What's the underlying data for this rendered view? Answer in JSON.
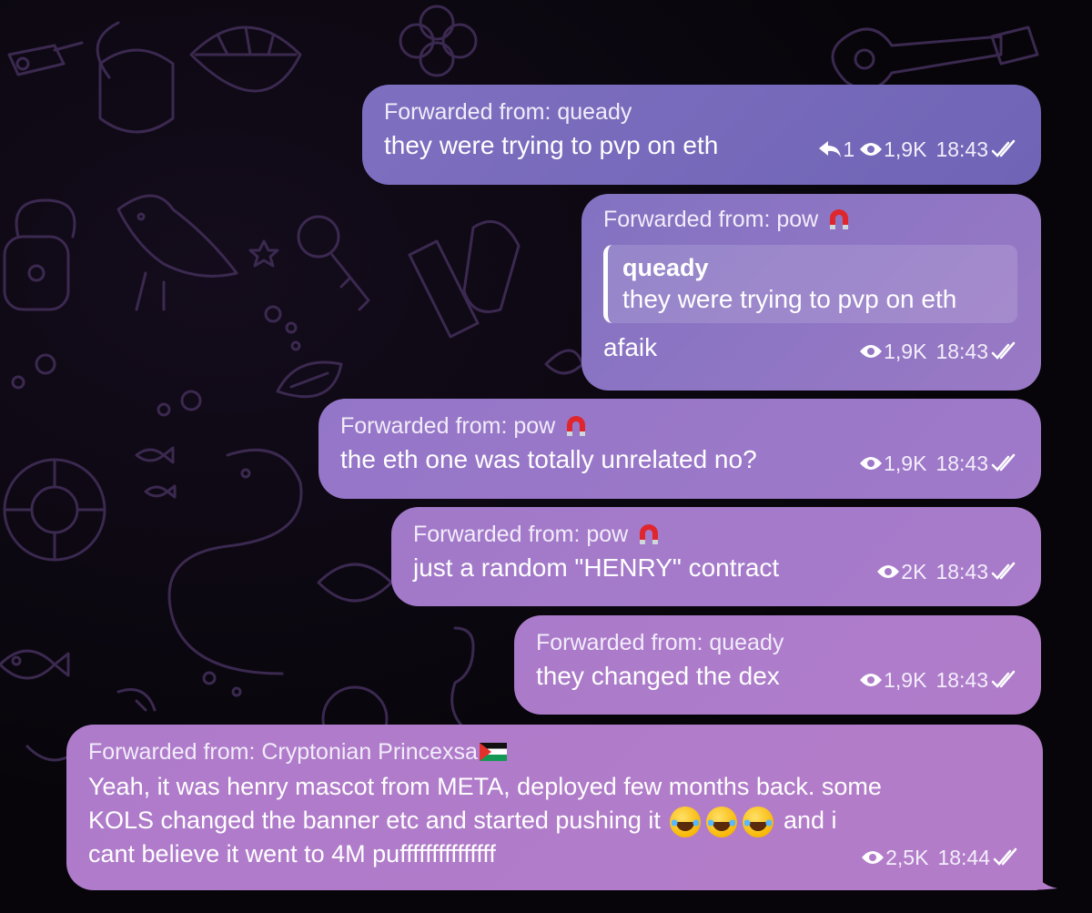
{
  "messages": [
    {
      "forwarded_from": "Forwarded from: queady",
      "text": "they were trying to pvp on eth",
      "replies": "1",
      "views": "1,9K",
      "time": "18:43",
      "badge_emoji": null
    },
    {
      "forwarded_from": "Forwarded from: pow",
      "badge_emoji": "magnet",
      "quote": {
        "author": "queady",
        "text": "they were trying to pvp on eth"
      },
      "text": "afaik",
      "views": "1,9K",
      "time": "18:43"
    },
    {
      "forwarded_from": "Forwarded from: pow",
      "badge_emoji": "magnet",
      "text": "the eth one was totally unrelated no?",
      "views": "1,9K",
      "time": "18:43"
    },
    {
      "forwarded_from": "Forwarded from: pow",
      "badge_emoji": "magnet",
      "text": "just a random \"HENRY\" contract",
      "views": "2K",
      "time": "18:43"
    },
    {
      "forwarded_from": "Forwarded from: queady",
      "text": "they changed the dex",
      "views": "1,9K",
      "time": "18:43"
    },
    {
      "forwarded_from": "Forwarded from: Cryptonian Princexsa",
      "badge_emoji": "flag-palestine",
      "text_lines": [
        "Yeah, it was henry mascot from META, deployed few months back. some",
        "KOLS changed the banner etc and started pushing it",
        "and i",
        "cant believe it went to 4M pufffffffffffffff"
      ],
      "inline_emoji": [
        "face-with-tears-of-joy",
        "face-with-tears-of-joy",
        "face-with-tears-of-joy"
      ],
      "views": "2,5K",
      "time": "18:44"
    }
  ],
  "colors": {
    "bubble_top": "#6f64b6",
    "bubble_bottom": "#b27ac8",
    "background": "#07050a",
    "wallpaper_lines": "#3b2950"
  }
}
